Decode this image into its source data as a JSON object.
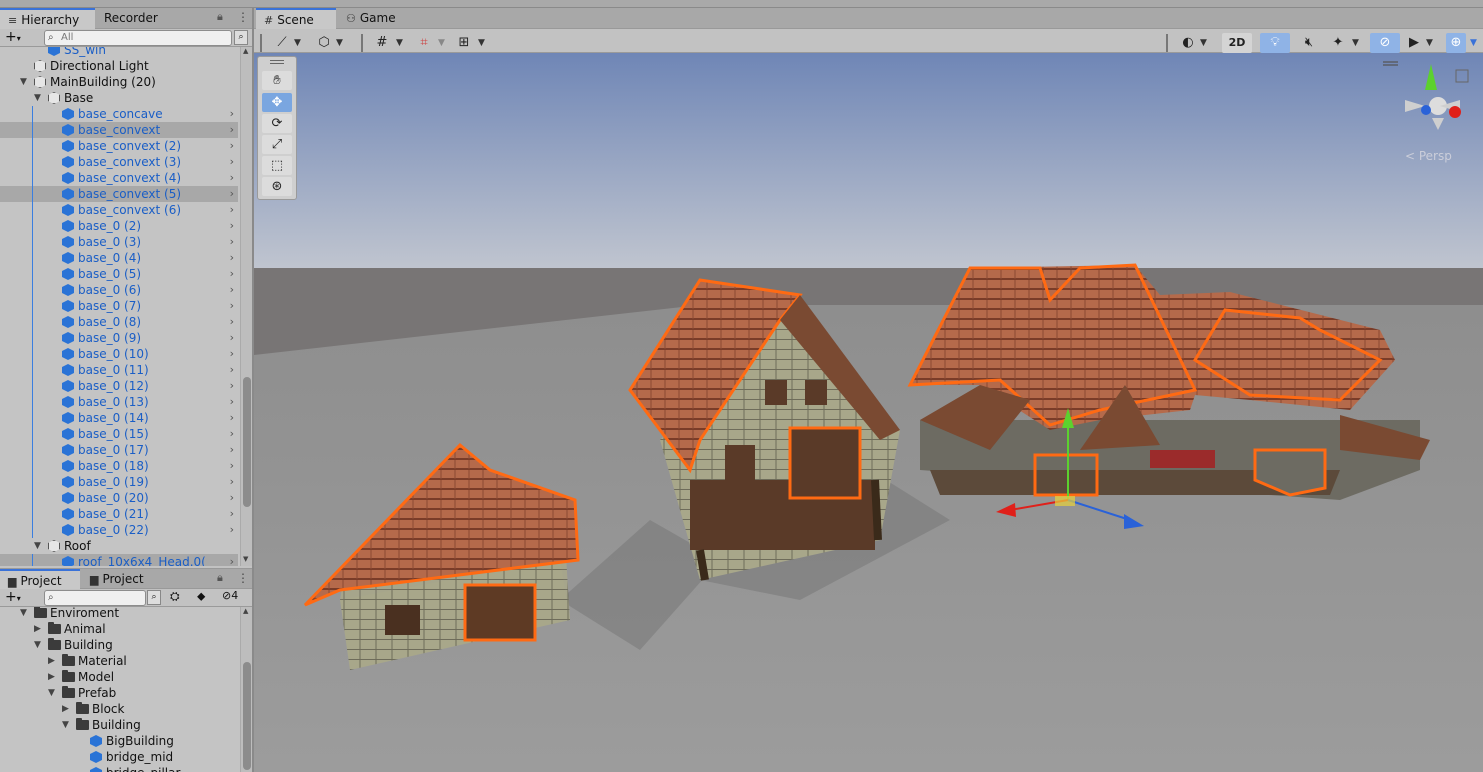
{
  "colors": {
    "accent": "#3a72d8",
    "prefab_text": "#1a5ec6",
    "selection_outline": "#ff6a13"
  },
  "hierarchy": {
    "tabs": [
      "Hierarchy",
      "Recorder"
    ],
    "search_placeholder": "All",
    "add_label": "+",
    "rows": [
      {
        "label": "SS_win",
        "indent": 2,
        "prefab": true,
        "selected": false,
        "arrow": "",
        "chev": false,
        "partial": true
      },
      {
        "label": "Directional Light",
        "indent": 1,
        "prefab": false,
        "selected": false,
        "arrow": "",
        "chev": false
      },
      {
        "label": "MainBuilding (20)",
        "indent": 1,
        "prefab": false,
        "selected": false,
        "arrow": "▼",
        "chev": false
      },
      {
        "label": "Base",
        "indent": 2,
        "prefab": false,
        "selected": false,
        "arrow": "▼",
        "chev": false
      },
      {
        "label": "base_concave",
        "indent": 3,
        "prefab": true,
        "selected": false,
        "arrow": "",
        "chev": true
      },
      {
        "label": "base_convext",
        "indent": 3,
        "prefab": true,
        "selected": true,
        "arrow": "",
        "chev": true
      },
      {
        "label": "base_convext (2)",
        "indent": 3,
        "prefab": true,
        "selected": false,
        "arrow": "",
        "chev": true
      },
      {
        "label": "base_convext (3)",
        "indent": 3,
        "prefab": true,
        "selected": false,
        "arrow": "",
        "chev": true
      },
      {
        "label": "base_convext (4)",
        "indent": 3,
        "prefab": true,
        "selected": false,
        "arrow": "",
        "chev": true
      },
      {
        "label": "base_convext (5)",
        "indent": 3,
        "prefab": true,
        "selected": true,
        "arrow": "",
        "chev": true
      },
      {
        "label": "base_convext (6)",
        "indent": 3,
        "prefab": true,
        "selected": false,
        "arrow": "",
        "chev": true
      },
      {
        "label": "base_0 (2)",
        "indent": 3,
        "prefab": true,
        "selected": false,
        "arrow": "",
        "chev": true
      },
      {
        "label": "base_0 (3)",
        "indent": 3,
        "prefab": true,
        "selected": false,
        "arrow": "",
        "chev": true
      },
      {
        "label": "base_0 (4)",
        "indent": 3,
        "prefab": true,
        "selected": false,
        "arrow": "",
        "chev": true
      },
      {
        "label": "base_0 (5)",
        "indent": 3,
        "prefab": true,
        "selected": false,
        "arrow": "",
        "chev": true
      },
      {
        "label": "base_0 (6)",
        "indent": 3,
        "prefab": true,
        "selected": false,
        "arrow": "",
        "chev": true
      },
      {
        "label": "base_0 (7)",
        "indent": 3,
        "prefab": true,
        "selected": false,
        "arrow": "",
        "chev": true
      },
      {
        "label": "base_0 (8)",
        "indent": 3,
        "prefab": true,
        "selected": false,
        "arrow": "",
        "chev": true
      },
      {
        "label": "base_0 (9)",
        "indent": 3,
        "prefab": true,
        "selected": false,
        "arrow": "",
        "chev": true
      },
      {
        "label": "base_0 (10)",
        "indent": 3,
        "prefab": true,
        "selected": false,
        "arrow": "",
        "chev": true
      },
      {
        "label": "base_0 (11)",
        "indent": 3,
        "prefab": true,
        "selected": false,
        "arrow": "",
        "chev": true
      },
      {
        "label": "base_0 (12)",
        "indent": 3,
        "prefab": true,
        "selected": false,
        "arrow": "",
        "chev": true
      },
      {
        "label": "base_0 (13)",
        "indent": 3,
        "prefab": true,
        "selected": false,
        "arrow": "",
        "chev": true
      },
      {
        "label": "base_0 (14)",
        "indent": 3,
        "prefab": true,
        "selected": false,
        "arrow": "",
        "chev": true
      },
      {
        "label": "base_0 (15)",
        "indent": 3,
        "prefab": true,
        "selected": false,
        "arrow": "",
        "chev": true
      },
      {
        "label": "base_0 (17)",
        "indent": 3,
        "prefab": true,
        "selected": false,
        "arrow": "",
        "chev": true
      },
      {
        "label": "base_0 (18)",
        "indent": 3,
        "prefab": true,
        "selected": false,
        "arrow": "",
        "chev": true
      },
      {
        "label": "base_0 (19)",
        "indent": 3,
        "prefab": true,
        "selected": false,
        "arrow": "",
        "chev": true
      },
      {
        "label": "base_0 (20)",
        "indent": 3,
        "prefab": true,
        "selected": false,
        "arrow": "",
        "chev": true
      },
      {
        "label": "base_0 (21)",
        "indent": 3,
        "prefab": true,
        "selected": false,
        "arrow": "",
        "chev": true
      },
      {
        "label": "base_0 (22)",
        "indent": 3,
        "prefab": true,
        "selected": false,
        "arrow": "",
        "chev": true
      },
      {
        "label": "Roof",
        "indent": 2,
        "prefab": false,
        "selected": false,
        "arrow": "▼",
        "chev": false
      },
      {
        "label": "roof_10x6x4_Head.0(",
        "indent": 3,
        "prefab": true,
        "selected": true,
        "arrow": "",
        "chev": true
      }
    ]
  },
  "project": {
    "tabs": [
      "Project",
      "Project"
    ],
    "hidden_count": "4",
    "add_label": "+",
    "rows": [
      {
        "label": "Enviroment",
        "indent": 1,
        "arrow": "▼",
        "type": "folder-open"
      },
      {
        "label": "Animal",
        "indent": 2,
        "arrow": "▶",
        "type": "folder"
      },
      {
        "label": "Building",
        "indent": 2,
        "arrow": "▼",
        "type": "folder-open"
      },
      {
        "label": "Material",
        "indent": 3,
        "arrow": "▶",
        "type": "folder"
      },
      {
        "label": "Model",
        "indent": 3,
        "arrow": "▶",
        "type": "folder"
      },
      {
        "label": "Prefab",
        "indent": 3,
        "arrow": "▼",
        "type": "folder-open"
      },
      {
        "label": "Block",
        "indent": 4,
        "arrow": "▶",
        "type": "folder"
      },
      {
        "label": "Building",
        "indent": 4,
        "arrow": "▼",
        "type": "folder-open"
      },
      {
        "label": "BigBuilding",
        "indent": 5,
        "arrow": "",
        "type": "prefab"
      },
      {
        "label": "bridge_mid",
        "indent": 5,
        "arrow": "",
        "type": "prefab"
      },
      {
        "label": "bridge_pillar",
        "indent": 5,
        "arrow": "",
        "type": "prefab"
      }
    ]
  },
  "scene_view": {
    "tabs": [
      "Scene",
      "Game"
    ],
    "mode_2d": "2D",
    "tools": [
      "hand-tool",
      "move-tool",
      "rotate-tool",
      "scale-tool",
      "rect-tool",
      "transform-tool"
    ],
    "active_tool": "move-tool",
    "gizmo_label": "< Persp"
  }
}
